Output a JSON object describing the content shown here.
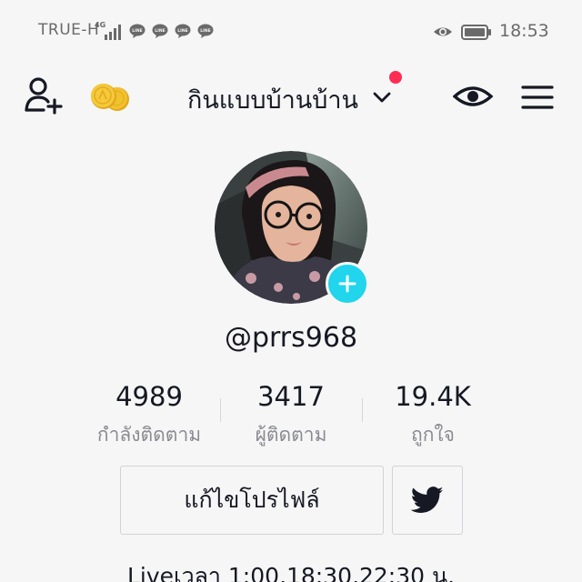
{
  "status_bar": {
    "carrier": "TRUE-H",
    "network_type": "4G",
    "time": "18:53",
    "notification_icons": [
      "line-icon",
      "line-icon",
      "line-icon",
      "line-icon"
    ],
    "right_icons": [
      "eye-icon",
      "battery-icon"
    ]
  },
  "header": {
    "account_name": "กินแบบบ้านบ้าน",
    "left_icons": [
      "add-user-icon",
      "coins-icon"
    ],
    "right_icons": [
      "eye-icon",
      "menu-icon"
    ],
    "has_notification_dot": true
  },
  "profile": {
    "username": "@prrs968",
    "stats": [
      {
        "value": "4989",
        "label": "กำลังติดตาม"
      },
      {
        "value": "3417",
        "label": "ผู้ติดตาม"
      },
      {
        "value": "19.4K",
        "label": "ถูกใจ"
      }
    ],
    "edit_profile_label": "แก้ไขโปรไฟล์",
    "bio": "Liveเวลา 1:00,18:30,22:30 น."
  },
  "colors": {
    "accent_cyan": "#20d5ec",
    "notification_red": "#fe2c55",
    "twitter_dark": "#161823",
    "coin_gold": "#f2c12e"
  }
}
